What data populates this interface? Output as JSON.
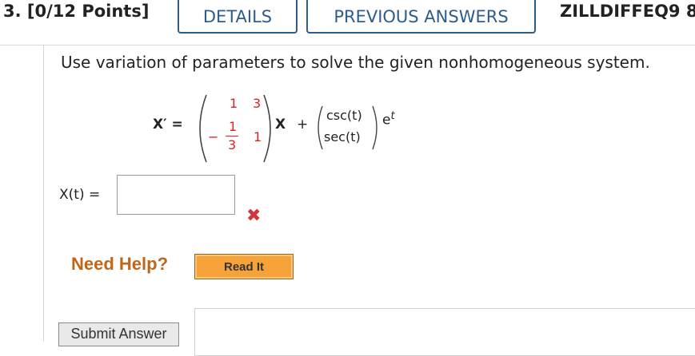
{
  "header": {
    "question_number": "3.",
    "points": "[0/12 Points]",
    "details_label": "DETAILS",
    "previous_answers_label": "PREVIOUS ANSWERS",
    "assignment_code": "ZILLDIFFEQ9 8"
  },
  "question": {
    "instruction": "Use variation of parameters to solve the given nonhomogeneous system.",
    "equation": {
      "lhs": "X′ =",
      "matrix": {
        "r1c1": "1",
        "r1c2": "3",
        "r2c1_sign": "−",
        "r2c1_num": "1",
        "r2c1_den": "3",
        "r2c2": "1"
      },
      "x_symbol": "X",
      "plus": "+",
      "vector": [
        "csc(t)",
        "sec(t)"
      ],
      "exp_base": "e",
      "exp_power": "t"
    },
    "answer_label": "X(t) =",
    "answer_value": "",
    "status": "incorrect"
  },
  "help": {
    "need_help": "Need Help?",
    "read_it": "Read It"
  },
  "actions": {
    "submit_label": "Submit Answer"
  },
  "colors": {
    "button_border": "#2d5d8a",
    "matrix_red": "#d22222",
    "incorrect_mark": "#d3343e",
    "need_help": "#c0661a",
    "read_it_bg": "#f5a339"
  }
}
